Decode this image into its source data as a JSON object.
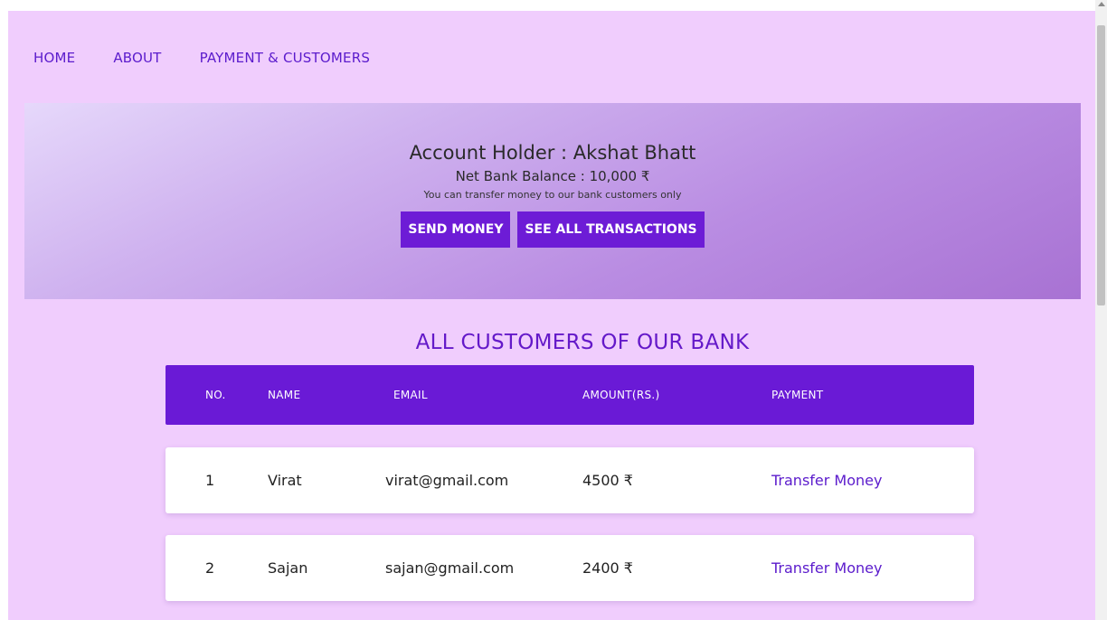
{
  "nav": {
    "items": [
      "HOME",
      "ABOUT",
      "PAYMENT & CUSTOMERS"
    ]
  },
  "hero": {
    "holder": "Account Holder : Akshat Bhatt",
    "balance": "Net Bank Balance : 10,000 ₹",
    "note": "You can transfer money to our bank customers only",
    "send_label": "SEND MONEY",
    "transactions_label": "SEE ALL TRANSACTIONS"
  },
  "customers": {
    "title": "ALL CUSTOMERS OF OUR BANK",
    "columns": [
      "NO.",
      "NAME",
      "EMAIL",
      "AMOUNT(RS.)",
      "PAYMENT"
    ],
    "rows": [
      {
        "no": "1",
        "name": "Virat",
        "email": "virat@gmail.com",
        "amount": "4500 ₹",
        "action": "Transfer Money"
      },
      {
        "no": "2",
        "name": "Sajan",
        "email": "sajan@gmail.com",
        "amount": "2400 ₹",
        "action": "Transfer Money"
      }
    ]
  },
  "colors": {
    "page_bg": "#f0cdfd",
    "accent": "#6a1ad6",
    "link": "#5b1bcc"
  }
}
